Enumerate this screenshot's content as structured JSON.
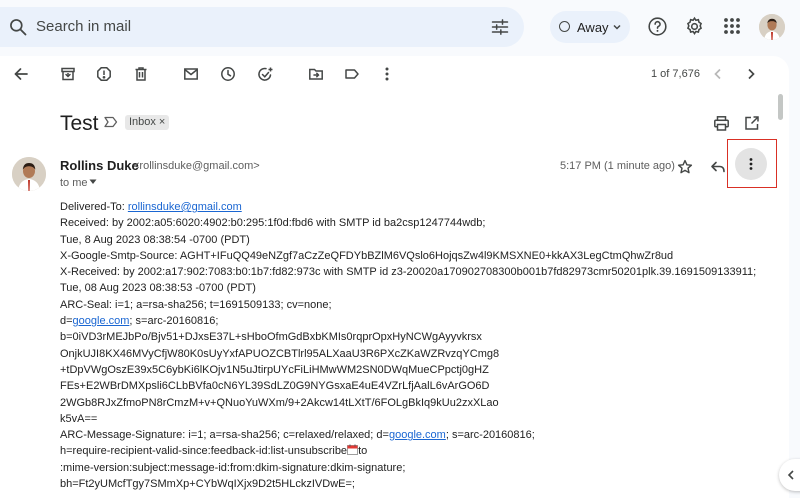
{
  "search": {
    "placeholder": "Search in mail"
  },
  "status": {
    "label": "Away"
  },
  "toolbar": {
    "counter": "1 of 7,676"
  },
  "email": {
    "subject": "Test",
    "label": "Inbox",
    "label_remove": "×",
    "sender_name": "Rollins Duke",
    "sender_email": "<rollinsduke@gmail.com>",
    "recipient": "to me",
    "time": "5:17 PM (1 minute ago)",
    "body": {
      "l1_pre": "Delivered-To: ",
      "l1_link": "rollinsduke@gmail.com",
      "l2": "Received: by 2002:a05:6020:4902:b0:295:1f0d:fbd6 with SMTP id ba2csp1247744wdb;",
      "l3": "Tue, 8 Aug 2023 08:38:54 -0700 (PDT)",
      "l4": "X-Google-Smtp-Source: AGHT+IFuQQ49eNZgf7aCzZeQFDYbBZlM6VQslo6HojqsZw4l9KMSXNE0+kkAX3LegCtmQhwZr8ud",
      "l5": "X-Received: by 2002:a17:902:7083:b0:1b7:fd82:973c with SMTP id z3-20020a170902708300b001b7fd82973cmr50201plk.39.1691509133911;",
      "l6": "Tue, 08 Aug 2023 08:38:53 -0700 (PDT)",
      "l7": "ARC-Seal: i=1; a=rsa-sha256; t=1691509133; cv=none;",
      "l8_pre": "d=",
      "l8_link": "google.com",
      "l8_post": "; s=arc-20160816;",
      "l9": "b=0iVD3rMEJbPo/Bjv51+DJxsE37L+sHboOfmGdBxbKMIs0rqprOpxHyNCWgAyyvkrsx",
      "l10": "OnjkUJI8KX46MVyCfjW80K0sUyYxfAPUOZCBTlrl95ALXaaU3R6PXcZKaWZRvzqYCmg8",
      "l11": "+tDpVWgOszE39x5C6ybKi6lKOjv1N5uJtirpUYcFiLiHMwWM2SN0DWqMueCPpctj0gHZ",
      "l12": "FEs+E2WBrDMXpsli6CLbBVfa0cN6YL39SdLZ0G9NYGsxaE4uE4VZrLfjAalL6vArGO6D",
      "l13": "2WGb8RJxZfmoPN8rCmzM+v+QNuoYuWXm/9+2Akcw14tLXtT/6FOLgBkIq9kUu2zxXLao",
      "l14": "k5vA==",
      "l15_pre": "ARC-Message-Signature: i=1; a=rsa-sha256; c=relaxed/relaxed; d=",
      "l15_link": "google.com",
      "l15_post": "; s=arc-20160816;",
      "l16_pre": "h=require-recipient-valid-since:feedback-id:list-unsubscribe",
      "l16_post": "to",
      "l17": ":mime-version:subject:message-id:from:dkim-signature:dkim-signature;",
      "l18": "bh=Ft2yUMcfTgy7SMmXp+CYbWqIXjx9D2t5HLckzIVDwE=;"
    }
  },
  "colors": {
    "accent": "#1a66d2",
    "highlight_box": "#d93025",
    "search_bg": "#eaf1fb"
  }
}
